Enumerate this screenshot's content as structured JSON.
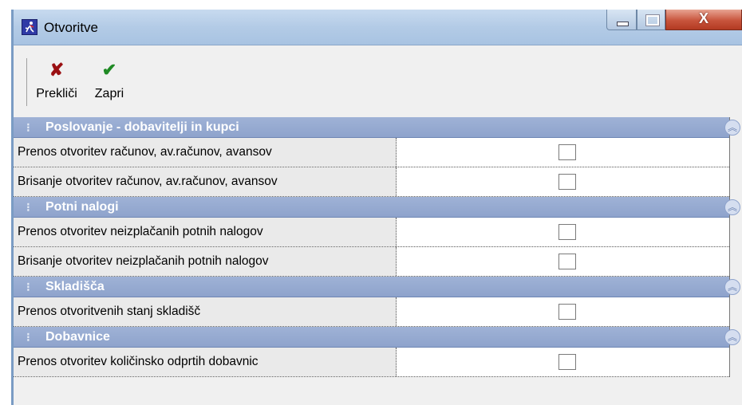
{
  "window": {
    "title": "Otvoritve",
    "close_glyph": "X"
  },
  "toolbar": {
    "cancel": {
      "label": "Prekliči",
      "icon": "red-x-icon",
      "glyph": "✘",
      "color": "#9a0f12"
    },
    "close": {
      "label": "Zapri",
      "icon": "green-check-icon",
      "glyph": "✔",
      "color": "#1f8a24"
    }
  },
  "sections": [
    {
      "title": "Poslovanje - dobavitelji in kupci",
      "items": [
        {
          "label": "Prenos otvoritev računov, av.računov, avansov",
          "checked": false
        },
        {
          "label": "Brisanje otvoritev računov, av.računov, avansov",
          "checked": false
        }
      ]
    },
    {
      "title": "Potni nalogi",
      "items": [
        {
          "label": "Prenos otvoritev neizplačanih potnih nalogov",
          "checked": false
        },
        {
          "label": "Brisanje otvoritev neizplačanih potnih nalogov",
          "checked": false
        }
      ]
    },
    {
      "title": "Skladišča",
      "items": [
        {
          "label": "Prenos otvoritvenih stanj skladišč",
          "checked": false
        }
      ]
    },
    {
      "title": "Dobavnice",
      "items": [
        {
          "label": "Prenos otvoritev količinsko odprtih dobavnic",
          "checked": false
        }
      ]
    }
  ],
  "colors": {
    "section_header": "#8ea3cc",
    "label_cell": "#eaeaea",
    "titlebar": "#b3cbe6"
  }
}
